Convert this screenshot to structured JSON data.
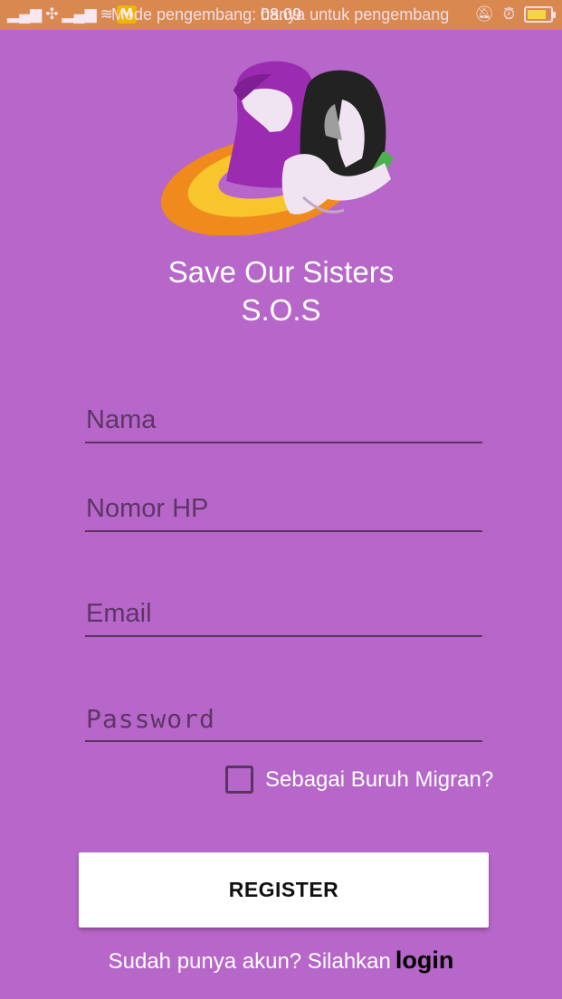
{
  "status_bar": {
    "notification_text": "Mode pengembang: hanya untuk pengembang",
    "time": "08.09",
    "badge_letter": "M"
  },
  "app": {
    "title_line1": "Save Our Sisters",
    "title_line2": "S.O.S"
  },
  "form": {
    "name_placeholder": "Nama",
    "phone_placeholder": "Nomor HP",
    "email_placeholder": "Email",
    "password_placeholder": "Password",
    "migrant_checkbox_label": "Sebagai Buruh Migran?",
    "migrant_checked": false,
    "register_label": "REGISTER"
  },
  "footer": {
    "prompt": "Sudah punya akun? Silahkan",
    "login_label": "login"
  },
  "colors": {
    "background": "#b767c9",
    "status_bar": "#d9884f",
    "underline": "#5b3262",
    "button": "#ffffff"
  },
  "icons": [
    "signal-icon",
    "wifi-icon",
    "m-badge-icon",
    "bell-off-icon",
    "alarm-icon",
    "battery-icon"
  ]
}
